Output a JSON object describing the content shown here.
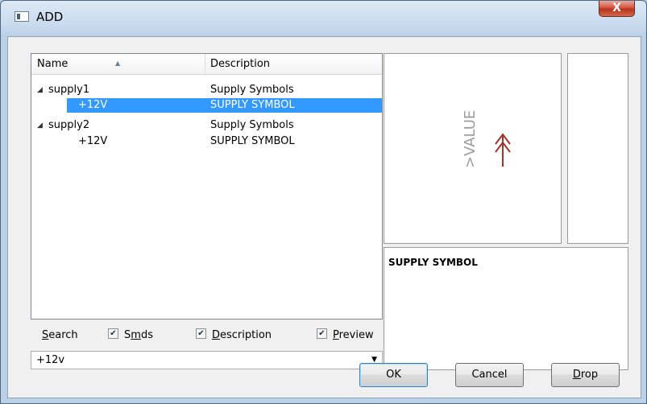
{
  "window": {
    "title": "ADD",
    "close_glyph": "X"
  },
  "tree": {
    "columns": {
      "name": "Name",
      "description": "Description"
    },
    "rows": [
      {
        "name": "supply1",
        "description": "Supply Symbols",
        "level": 0,
        "expanded": true,
        "selected": false
      },
      {
        "name": "+12V",
        "description": "SUPPLY SYMBOL",
        "level": 1,
        "expanded": false,
        "selected": true
      },
      {
        "name": "supply2",
        "description": "Supply Symbols",
        "level": 0,
        "expanded": true,
        "selected": false
      },
      {
        "name": "+12V",
        "description": "SUPPLY SYMBOL",
        "level": 1,
        "expanded": false,
        "selected": false
      }
    ]
  },
  "search": {
    "label": "Search",
    "options": [
      {
        "label": "Smds",
        "checked": true
      },
      {
        "label": "Description",
        "checked": true
      },
      {
        "label": "Preview",
        "checked": true
      }
    ],
    "value": "+12v"
  },
  "preview": {
    "symbol_text": ">VALUE",
    "symbol_icon": "supply-arrow-icon",
    "symbol_color": "#a0332a",
    "description": "SUPPLY SYMBOL"
  },
  "buttons": {
    "ok": "OK",
    "cancel": "Cancel",
    "drop": "Drop"
  },
  "colors": {
    "selection": "#3399ff",
    "close_button": "#c94a32"
  }
}
